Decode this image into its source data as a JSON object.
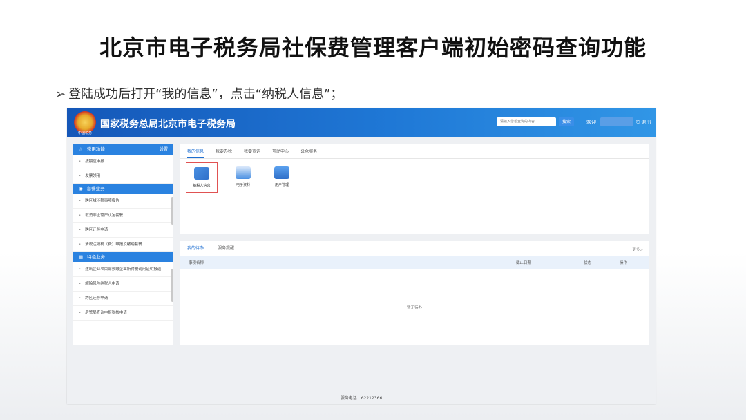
{
  "slide": {
    "title": "北京市电子税务局社保费管理客户端初始密码查询功能",
    "bullet_arrow": "➢",
    "bullet": "登陆成功后打开“我的信息”，点击“纳税人信息”；"
  },
  "header": {
    "emblem_caption": "中国税务",
    "site_title": "国家税务总局北京市电子税务局",
    "search_placeholder": "请输入您想查询的内容",
    "search_button": "搜索",
    "welcome": "欢迎",
    "logout": "退出"
  },
  "sidebar": {
    "sections": [
      {
        "title": "常用功能",
        "action": "设置",
        "items": [
          "按期应申报",
          "发票领用"
        ]
      },
      {
        "title": "套餐业务",
        "items": [
          "跨区域涉税事项报告",
          "取消非正常户认定套餐",
          "跨区迁移申请",
          "清税注销税（费）申报及缴纳套餐"
        ]
      },
      {
        "title": "特色业务",
        "items": [
          "建筑企业项目部预缴企业所得税询问证明报送",
          "解除风险纳税人申请",
          "跨区迁移申请",
          "房管局查询申报税核申请"
        ]
      }
    ]
  },
  "top_card": {
    "tabs": [
      "我的信息",
      "我要办税",
      "我要查询",
      "互动中心",
      "公众服务"
    ],
    "active_tab": 0,
    "apps": [
      {
        "label": "纳税人信息",
        "selected": true
      },
      {
        "label": "电子资料",
        "selected": false
      },
      {
        "label": "用户管理",
        "selected": false
      }
    ]
  },
  "bottom_card": {
    "tabs": [
      "我的待办",
      "服务提醒"
    ],
    "active_tab": 0,
    "more": "更多>",
    "columns": [
      "事项名称",
      "截止日期",
      "状态",
      "操作"
    ],
    "empty_text": "暂无待办"
  },
  "footer": {
    "hotline": "服务电话：62212366"
  },
  "colors": {
    "topbar": "#1f78d6",
    "accent": "#1f6fd1",
    "section_head": "#2a82e0",
    "selected_border": "#e05252"
  }
}
